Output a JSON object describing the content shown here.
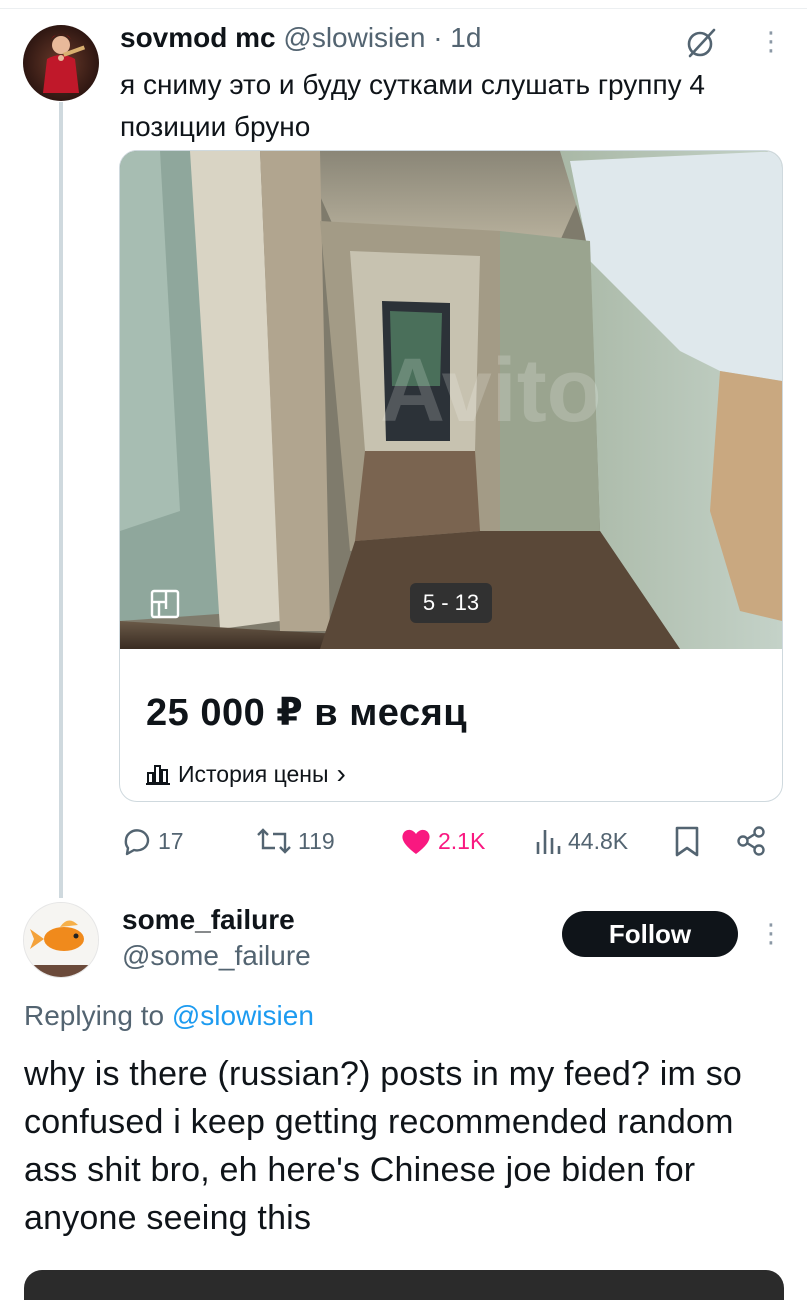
{
  "tweet1": {
    "author_name": "sovmod mc",
    "author_handle": "@slowisien",
    "time": "· 1d",
    "more": "⋮",
    "text": "я сниму это и буду сутками слушать группу 4 позиции бруно",
    "card": {
      "image_counter": "5 - 13",
      "price": "25 000 ₽ в месяц",
      "price_history": "История цены",
      "chevron": "›"
    },
    "actions": {
      "replies": "17",
      "reposts": "119",
      "likes": "2.1K",
      "views": "44.8K"
    }
  },
  "tweet2": {
    "author_name": "some_failure",
    "author_handle": "@some_failure",
    "follow_label": "Follow",
    "more": "⋮",
    "replying_prefix": "Replying to ",
    "replying_mention": "@slowisien",
    "text": "why is there (russian?) posts in my feed? im so confused i keep getting recommended random ass shit bro, eh here's Chinese joe biden for anyone seeing this"
  },
  "colors": {
    "like_pink": "#f91880",
    "link_blue": "#1d9bf0",
    "secondary_text": "#536471",
    "follow_bg": "#0f1419"
  },
  "icons": [
    "grok-icon",
    "more-icon",
    "floor-plan-icon",
    "chart-icon",
    "reply-icon",
    "repost-icon",
    "heart-icon",
    "views-icon",
    "bookmark-icon",
    "share-icon"
  ]
}
